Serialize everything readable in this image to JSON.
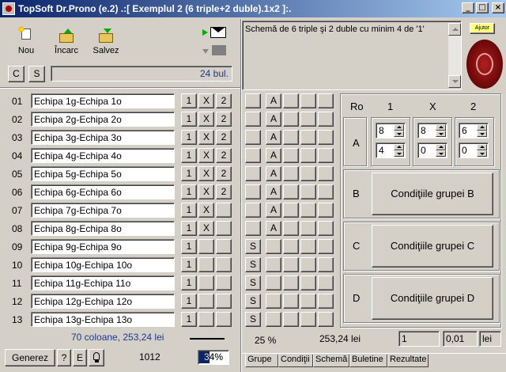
{
  "window": {
    "title": "TopSoft Dr.Prono (e.2) .:[ Exemplul 2 (6 triple+2 duble).1x2 ]:.",
    "min": "_",
    "max": "□",
    "close": "×"
  },
  "toolbar": {
    "nou": "Nou",
    "incarc": "Încarc",
    "salvez": "Salvez"
  },
  "filter": {
    "c_label": "C",
    "s_label": "S",
    "count": "24 bul."
  },
  "rows": [
    {
      "num": "01",
      "team": "Echipa 1g-Echipa 1o",
      "c1": "1",
      "cx": "X",
      "c2": "2"
    },
    {
      "num": "02",
      "team": "Echipa 2g-Echipa 2o",
      "c1": "1",
      "cx": "X",
      "c2": "2"
    },
    {
      "num": "03",
      "team": "Echipa 3g-Echipa 3o",
      "c1": "1",
      "cx": "X",
      "c2": "2"
    },
    {
      "num": "04",
      "team": "Echipa 4g-Echipa 4o",
      "c1": "1",
      "cx": "X",
      "c2": "2"
    },
    {
      "num": "05",
      "team": "Echipa 5g-Echipa 5o",
      "c1": "1",
      "cx": "X",
      "c2": "2"
    },
    {
      "num": "06",
      "team": "Echipa 6g-Echipa 6o",
      "c1": "1",
      "cx": "X",
      "c2": "2"
    },
    {
      "num": "07",
      "team": "Echipa 7g-Echipa 7o",
      "c1": "1",
      "cx": "X",
      "c2": ""
    },
    {
      "num": "08",
      "team": "Echipa 8g-Echipa 8o",
      "c1": "1",
      "cx": "X",
      "c2": ""
    },
    {
      "num": "09",
      "team": "Echipa 9g-Echipa 9o",
      "c1": "1",
      "cx": "",
      "c2": ""
    },
    {
      "num": "10",
      "team": "Echipa 10g-Echipa 10o",
      "c1": "1",
      "cx": "",
      "c2": ""
    },
    {
      "num": "11",
      "team": "Echipa 11g-Echipa 11o",
      "c1": "1",
      "cx": "",
      "c2": ""
    },
    {
      "num": "12",
      "team": "Echipa 12g-Echipa 12o",
      "c1": "1",
      "cx": "",
      "c2": ""
    },
    {
      "num": "13",
      "team": "Echipa 13g-Echipa 13o",
      "c1": "1",
      "cx": "",
      "c2": ""
    }
  ],
  "summary": {
    "columns": "70 coloane, 253,24 lei"
  },
  "bottom_left": {
    "generez": "Generez",
    "q": "?",
    "e": "E",
    "count": "1012",
    "progress_text": "34%",
    "progress_value": 34
  },
  "schema": {
    "text": "Schemă de 6 triple şi 2 duble cu minim 4  de '1'",
    "help": "Ajutor",
    "sign_col": [
      "",
      "",
      "",
      "",
      "",
      "",
      "",
      "",
      "S",
      "S",
      "S",
      "S",
      "S"
    ],
    "group_col": [
      "A",
      "A",
      "A",
      "A",
      "A",
      "A",
      "A",
      "A",
      "",
      "",
      "",
      "",
      ""
    ]
  },
  "groups": {
    "header_ro": "Ro",
    "header_1": "1",
    "header_x": "X",
    "header_2": "2",
    "A": {
      "label": "A",
      "spin1_top": "8",
      "spinx_top": "8",
      "spin2_top": "6",
      "spin1_bot": "4",
      "spinx_bot": "0",
      "spin2_bot": "0"
    },
    "B": {
      "label": "B",
      "button": "Condiţiile grupei B"
    },
    "C": {
      "label": "C",
      "button": "Condiţiile grupei C"
    },
    "D": {
      "label": "D",
      "button": "Condiţiile grupei D"
    }
  },
  "status_right": {
    "percent": "25 %",
    "amount": "253,24 lei",
    "field1": "1",
    "field2": "0,01",
    "unit": "lei"
  },
  "tabs": [
    "Grupe",
    "Condiţii",
    "Schemă",
    "Buletine",
    "Rezultate"
  ]
}
